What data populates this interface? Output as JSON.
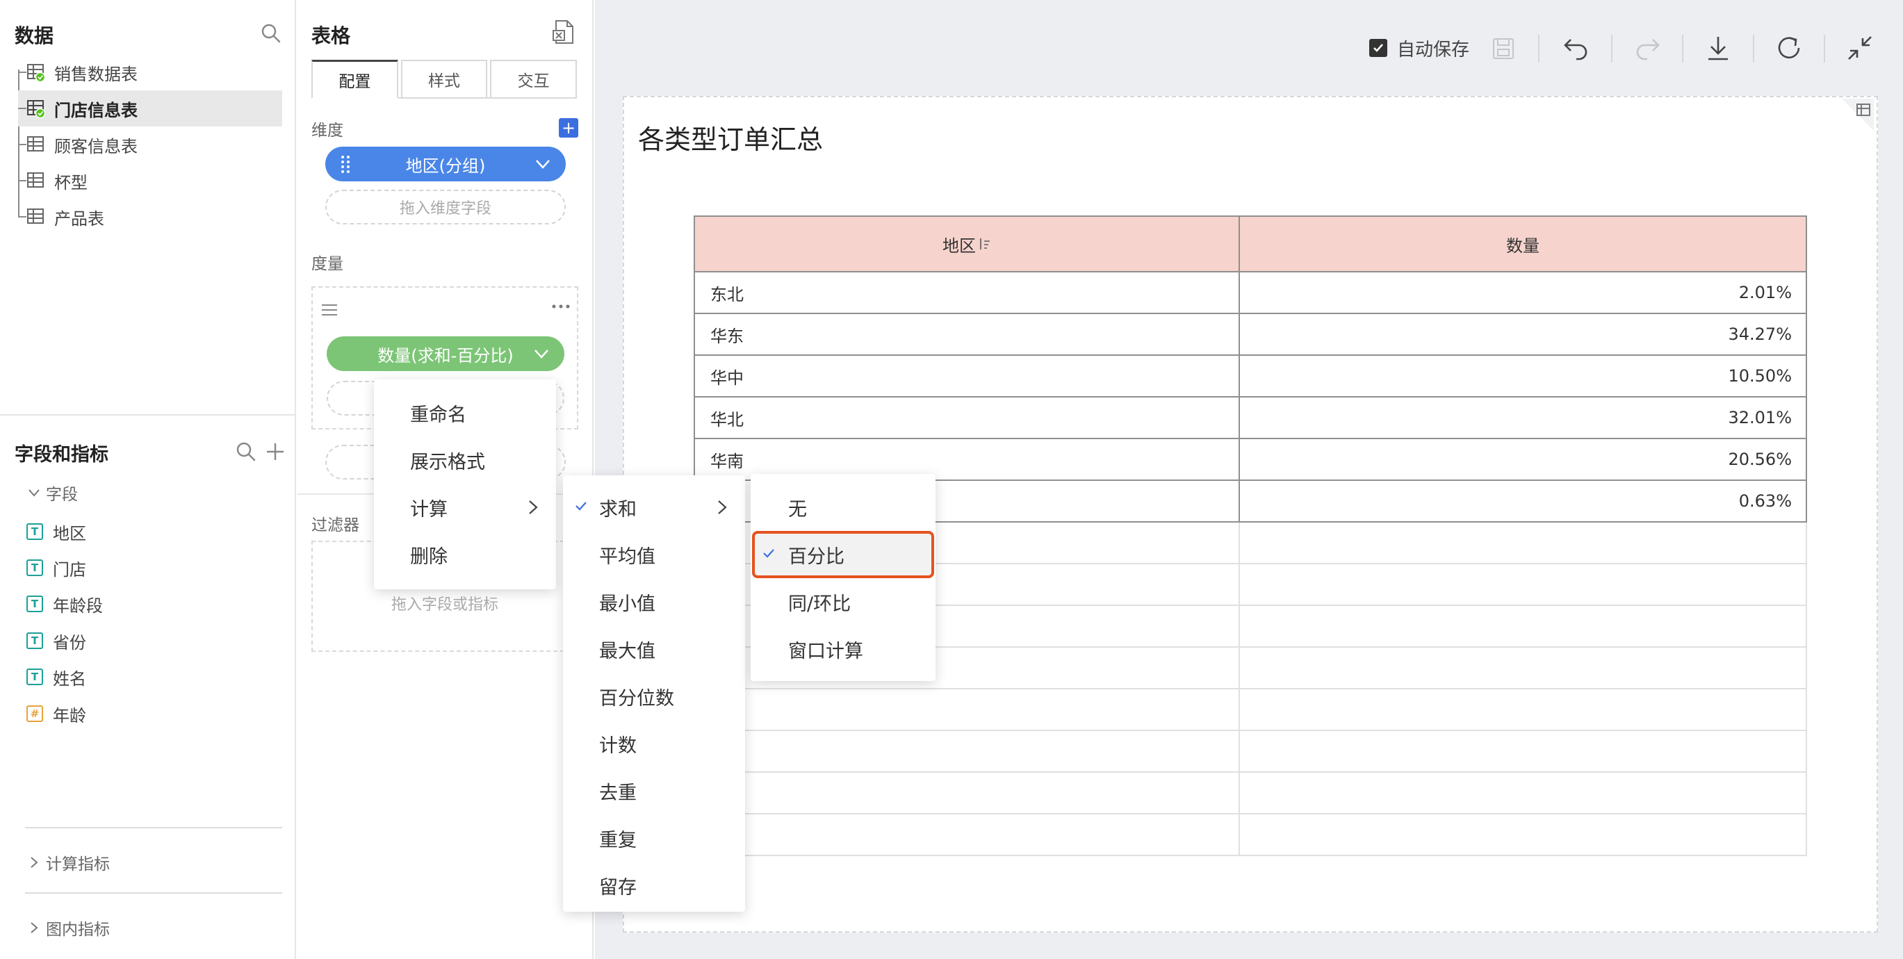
{
  "data_panel": {
    "title": "数据",
    "tables": [
      {
        "label": "销售数据表",
        "synced": true,
        "selected": false
      },
      {
        "label": "门店信息表",
        "synced": true,
        "selected": true
      },
      {
        "label": "顾客信息表",
        "synced": false,
        "selected": false
      },
      {
        "label": "杯型",
        "synced": false,
        "selected": false
      },
      {
        "label": "产品表",
        "synced": false,
        "selected": false
      }
    ]
  },
  "fields_panel": {
    "title": "字段和指标",
    "group_label": "字段",
    "fields": [
      {
        "label": "地区",
        "type": "T"
      },
      {
        "label": "门店",
        "type": "T"
      },
      {
        "label": "年龄段",
        "type": "T"
      },
      {
        "label": "省份",
        "type": "T"
      },
      {
        "label": "姓名",
        "type": "T"
      },
      {
        "label": "年龄",
        "type": "#"
      }
    ],
    "calc_metrics": "计算指标",
    "chart_metrics": "图内指标"
  },
  "config_panel": {
    "title": "表格",
    "tabs": [
      {
        "label": "配置",
        "active": true
      },
      {
        "label": "样式",
        "active": false
      },
      {
        "label": "交互",
        "active": false
      }
    ],
    "dimension_label": "维度",
    "dimension_pill": "地区(分组)",
    "dimension_drop": "拖入维度字段",
    "measure_label": "度量",
    "measure_pill": "数量(求和-百分比)",
    "filter_label": "过滤器",
    "filter_drop": "拖入字段或指标"
  },
  "toolbar": {
    "autosave_label": "自动保存",
    "autosave_checked": true
  },
  "chart": {
    "title": "各类型订单汇总",
    "header_color": "#f6d3cc"
  },
  "chart_data": {
    "type": "table",
    "columns": [
      "地区",
      "数量"
    ],
    "rows": [
      [
        "东北",
        "2.01%"
      ],
      [
        "华东",
        "34.27%"
      ],
      [
        "华中",
        "10.50%"
      ],
      [
        "华北",
        "32.01%"
      ],
      [
        "华南",
        "20.56%"
      ],
      [
        "",
        "0.63%"
      ]
    ]
  },
  "context_menu": {
    "items": [
      "重命名",
      "展示格式",
      "计算",
      "删除"
    ]
  },
  "calc_submenu": {
    "items": [
      {
        "label": "求和",
        "checked": true,
        "has_sub": true
      },
      {
        "label": "平均值"
      },
      {
        "label": "最小值"
      },
      {
        "label": "最大值"
      },
      {
        "label": "百分位数"
      },
      {
        "label": "计数"
      },
      {
        "label": "去重"
      },
      {
        "label": "重复"
      },
      {
        "label": "留存"
      }
    ]
  },
  "sum_submenu": {
    "items": [
      {
        "label": "无",
        "checked": false
      },
      {
        "label": "百分比",
        "checked": true
      },
      {
        "label": "同/环比",
        "checked": false
      },
      {
        "label": "窗口计算",
        "checked": false
      }
    ]
  },
  "colors": {
    "accent_blue": "#4a86e8",
    "measure_green": "#7cc576",
    "highlight_border": "#e5531f",
    "sync_green": "#52c41a"
  }
}
